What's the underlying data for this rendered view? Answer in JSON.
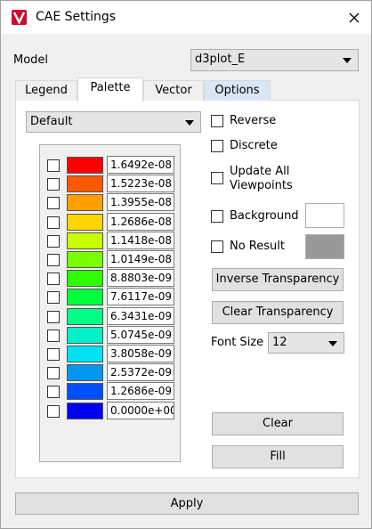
{
  "window": {
    "title": "CAE Settings"
  },
  "model": {
    "label": "Model",
    "value": "d3plot_E"
  },
  "tabs": [
    {
      "label": "Legend"
    },
    {
      "label": "Palette"
    },
    {
      "label": "Vector"
    },
    {
      "label": "Options"
    }
  ],
  "palette": {
    "preset": "Default",
    "rows": [
      {
        "color": "#ff0000",
        "value": "1.6492e-08"
      },
      {
        "color": "#ff5a00",
        "value": "1.5223e-08"
      },
      {
        "color": "#ffa000",
        "value": "1.3955e-08"
      },
      {
        "color": "#ffd500",
        "value": "1.2686e-08"
      },
      {
        "color": "#c8ff00",
        "value": "1.1418e-08"
      },
      {
        "color": "#78ff00",
        "value": "1.0149e-08"
      },
      {
        "color": "#2dff00",
        "value": "8.8803e-09"
      },
      {
        "color": "#00ff3c",
        "value": "7.6117e-09"
      },
      {
        "color": "#00ff87",
        "value": "6.3431e-09"
      },
      {
        "color": "#00f0c8",
        "value": "5.0745e-09"
      },
      {
        "color": "#00e1f5",
        "value": "3.8058e-09"
      },
      {
        "color": "#0096f0",
        "value": "2.5372e-09"
      },
      {
        "color": "#0050ff",
        "value": "1.2686e-09"
      },
      {
        "color": "#0000f0",
        "value": "0.0000e+00"
      }
    ]
  },
  "options": {
    "reverse": "Reverse",
    "discrete": "Discrete",
    "update_all_line1": "Update All",
    "update_all_line2": "Viewpoints",
    "background": "Background",
    "background_color": "#ffffff",
    "no_result": "No Result",
    "no_result_color": "#999999"
  },
  "buttons": {
    "inverse_transparency": "Inverse Transparency",
    "clear_transparency": "Clear Transparency",
    "clear": "Clear",
    "fill": "Fill",
    "apply": "Apply"
  },
  "font": {
    "label": "Font Size",
    "value": "12"
  }
}
